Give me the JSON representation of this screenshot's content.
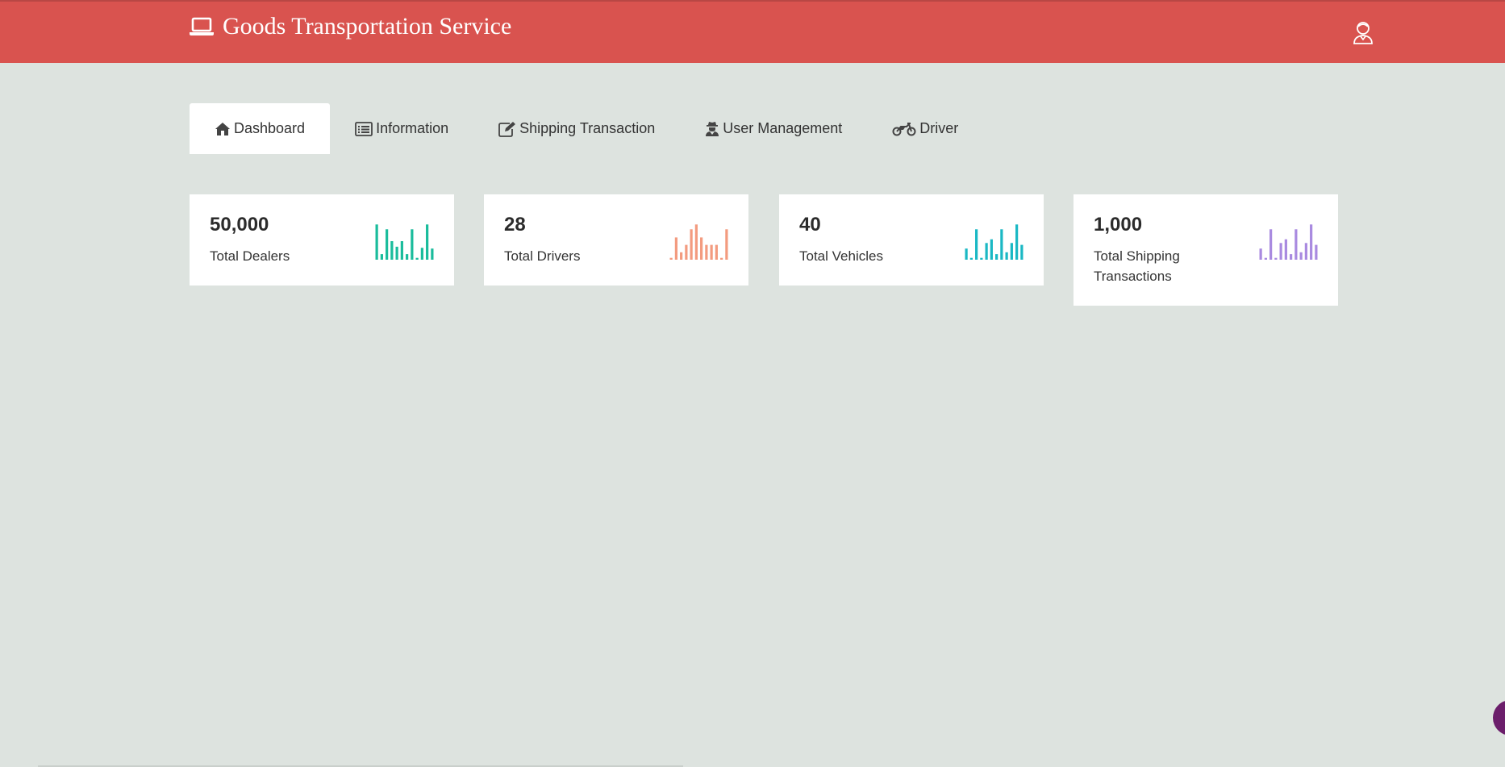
{
  "header": {
    "title": "Goods Transportation Service",
    "brand_icon": "laptop-icon",
    "user_icon": "user-avatar-icon",
    "background_color": "#d9534f"
  },
  "tabs": [
    {
      "label": "Dashboard",
      "icon": "home-icon",
      "active": true
    },
    {
      "label": "Information",
      "icon": "list-alt-icon",
      "active": false
    },
    {
      "label": "Shipping Transaction",
      "icon": "edit-icon",
      "active": false
    },
    {
      "label": "User Management",
      "icon": "user-secret-icon",
      "active": false
    },
    {
      "label": "Driver",
      "icon": "motorcycle-icon",
      "active": false
    }
  ],
  "stats": [
    {
      "value": "50,000",
      "label": "Total Dealers",
      "color": "#1abc9c",
      "bars": [
        0.95,
        0.15,
        0.82,
        0.5,
        0.35,
        0.5,
        0.15,
        0.82,
        0.05,
        0.32,
        0.95,
        0.3
      ]
    },
    {
      "value": "28",
      "label": "Total Drivers",
      "color": "#f39b7f",
      "bars": [
        0.05,
        0.6,
        0.2,
        0.4,
        0.82,
        0.95,
        0.6,
        0.4,
        0.4,
        0.4,
        0.05,
        0.82
      ]
    },
    {
      "value": "40",
      "label": "Total Vehicles",
      "color": "#1ab8c4",
      "bars": [
        0.3,
        0.05,
        0.82,
        0.05,
        0.45,
        0.55,
        0.15,
        0.82,
        0.2,
        0.45,
        0.95,
        0.4
      ]
    },
    {
      "value": "1,000",
      "label": "Total Shipping Transactions",
      "color": "#a98ae0",
      "bars": [
        0.3,
        0.05,
        0.82,
        0.05,
        0.45,
        0.55,
        0.15,
        0.82,
        0.2,
        0.45,
        0.95,
        0.4
      ]
    }
  ]
}
